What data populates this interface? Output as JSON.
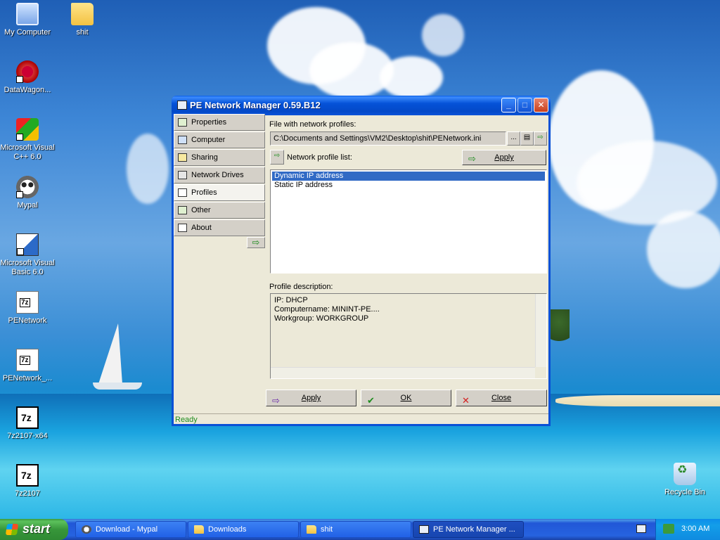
{
  "desktop": {
    "icons": [
      {
        "label": "My Computer"
      },
      {
        "label": "shit"
      },
      {
        "label": "DataWagon..."
      },
      {
        "label": "Microsoft Visual C++ 6.0"
      },
      {
        "label": "Mypal"
      },
      {
        "label": "Microsoft Visual Basic 6.0"
      },
      {
        "label": "PENetwork"
      },
      {
        "label": "PENetwork_..."
      },
      {
        "label": "7z2107-x64"
      },
      {
        "label": "7z2107"
      },
      {
        "label": "Recycle Bin"
      }
    ]
  },
  "window": {
    "title": "PE Network Manager 0.59.B12",
    "nav": [
      {
        "label": "Properties"
      },
      {
        "label": "Computer"
      },
      {
        "label": "Sharing"
      },
      {
        "label": "Network Drives"
      },
      {
        "label": "Profiles",
        "selected": true
      },
      {
        "label": "Other"
      },
      {
        "label": "About"
      }
    ],
    "file_label": "File with network profiles:",
    "file_path": "C:\\Documents and Settings\\VM2\\Desktop\\shit\\PENetwork.ini",
    "browse_label": "...",
    "list_label": "Network profile list:",
    "list_apply": "Apply",
    "profiles": [
      {
        "name": "Dynamic IP address",
        "selected": true
      },
      {
        "name": "Static IP address",
        "selected": false
      }
    ],
    "desc_label": "Profile description:",
    "desc_lines": [
      "IP: DHCP",
      "Computername: MININT-PE....",
      "Workgroup: WORKGROUP"
    ],
    "buttons": {
      "apply": "Apply",
      "ok": "OK",
      "close": "Close"
    },
    "status": "Ready"
  },
  "taskbar": {
    "start": "start",
    "tasks": [
      {
        "label": "Download - Mypal"
      },
      {
        "label": "Downloads"
      },
      {
        "label": "shit"
      },
      {
        "label": "PE Network Manager ..."
      }
    ],
    "clock": "3:00 AM"
  },
  "colors": {
    "titlebar": "#0a5fe6",
    "selection": "#316ac5",
    "status_text": "#1d8c1d"
  }
}
